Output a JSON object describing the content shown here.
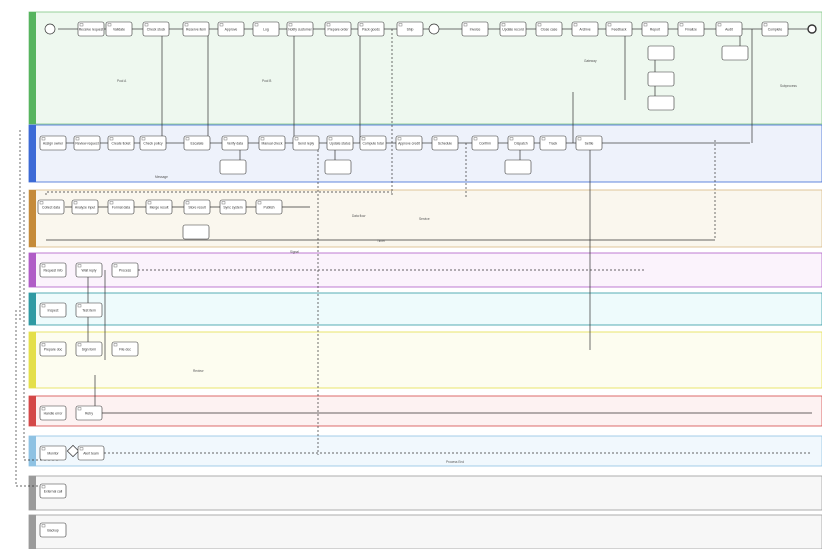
{
  "diagram": {
    "lanes": [
      {
        "key": "l1",
        "title": "",
        "fill": "#eef8ef",
        "border": "#57b45f"
      },
      {
        "key": "l2",
        "title": "",
        "fill": "#eef2fb",
        "border": "#3c6ad6"
      },
      {
        "key": "l3",
        "title": "",
        "fill": "#faf7ee",
        "border": "#c58b3a"
      },
      {
        "key": "l4",
        "title": "",
        "fill": "#fbf3fc",
        "border": "#b05cc7"
      },
      {
        "key": "l5",
        "title": "",
        "fill": "#eefbfc",
        "border": "#2f9aa3"
      },
      {
        "key": "l6",
        "title": "",
        "fill": "#fdfdf0",
        "border": "#e4df4a"
      },
      {
        "key": "l7",
        "title": "",
        "fill": "#fdf2f2",
        "border": "#d44848"
      },
      {
        "key": "l8",
        "title": "",
        "fill": "#f1f8fd",
        "border": "#8ec2e3"
      },
      {
        "key": "l9",
        "title": "",
        "fill": "#f7f7f7",
        "border": "#9a9a9a"
      },
      {
        "key": "l10",
        "title": "",
        "fill": "#f7f7f7",
        "border": "#9a9a9a"
      }
    ],
    "annotations": {
      "a1": "Pool A",
      "a2": "Pool B",
      "a3": "Gateway",
      "a4": "Subprocess",
      "a5": "Message",
      "a6": "Data flow",
      "a7": "Service",
      "a8": "Timer",
      "a9": "Signal",
      "a10": "Review",
      "a11": "Process End"
    },
    "tasks": [
      {
        "lane": "l1",
        "label": "Receive request"
      },
      {
        "lane": "l1",
        "label": "Validate"
      },
      {
        "lane": "l1",
        "label": "Check stock"
      },
      {
        "lane": "l1",
        "label": "Reserve item"
      },
      {
        "lane": "l1",
        "label": "Approve"
      },
      {
        "lane": "l1",
        "label": "Log"
      },
      {
        "lane": "l1",
        "label": "Notify customer"
      },
      {
        "lane": "l1",
        "label": "Prepare order"
      },
      {
        "lane": "l1",
        "label": "Pack goods"
      },
      {
        "lane": "l1",
        "label": "Ship"
      },
      {
        "lane": "l1",
        "label": "Invoice"
      },
      {
        "lane": "l1",
        "label": "Update record"
      },
      {
        "lane": "l1",
        "label": "Close case"
      },
      {
        "lane": "l1",
        "label": "Archive"
      },
      {
        "lane": "l1",
        "label": "Feedback"
      },
      {
        "lane": "l1",
        "label": "Report"
      },
      {
        "lane": "l1",
        "label": "Finalize"
      },
      {
        "lane": "l1",
        "label": "Audit"
      },
      {
        "lane": "l1",
        "label": "Complete"
      },
      {
        "lane": "l2",
        "label": "Assign owner"
      },
      {
        "lane": "l2",
        "label": "Review request"
      },
      {
        "lane": "l2",
        "label": "Create ticket"
      },
      {
        "lane": "l2",
        "label": "Check policy"
      },
      {
        "lane": "l2",
        "label": "Escalate"
      },
      {
        "lane": "l2",
        "label": "Verify data"
      },
      {
        "lane": "l2",
        "label": "Manual check"
      },
      {
        "lane": "l2",
        "label": "Send reply"
      },
      {
        "lane": "l2",
        "label": "Update status"
      },
      {
        "lane": "l2",
        "label": "Compute total"
      },
      {
        "lane": "l2",
        "label": "Approve credit"
      },
      {
        "lane": "l2",
        "label": "Schedule"
      },
      {
        "lane": "l2",
        "label": "Confirm"
      },
      {
        "lane": "l2",
        "label": "Dispatch"
      },
      {
        "lane": "l2",
        "label": "Track"
      },
      {
        "lane": "l2",
        "label": "Settle"
      },
      {
        "lane": "l3",
        "label": "Collect data"
      },
      {
        "lane": "l3",
        "label": "Analyze input"
      },
      {
        "lane": "l3",
        "label": "Format data"
      },
      {
        "lane": "l3",
        "label": "Merge result"
      },
      {
        "lane": "l3",
        "label": "Store result"
      },
      {
        "lane": "l3",
        "label": "Sync system"
      },
      {
        "lane": "l3",
        "label": "Publish"
      },
      {
        "lane": "l4",
        "label": "Request info"
      },
      {
        "lane": "l4",
        "label": "Wait reply"
      },
      {
        "lane": "l4",
        "label": "Process"
      },
      {
        "lane": "l5",
        "label": "Inspect"
      },
      {
        "lane": "l5",
        "label": "Test item"
      },
      {
        "lane": "l6",
        "label": "Prepare doc"
      },
      {
        "lane": "l6",
        "label": "Sign form"
      },
      {
        "lane": "l6",
        "label": "File doc"
      },
      {
        "lane": "l7",
        "label": "Handle error"
      },
      {
        "lane": "l7",
        "label": "Retry"
      },
      {
        "lane": "l8",
        "label": "Monitor"
      },
      {
        "lane": "l8",
        "label": "Alert team"
      },
      {
        "lane": "l9",
        "label": "External call"
      },
      {
        "lane": "l10",
        "label": "Backup"
      }
    ]
  }
}
